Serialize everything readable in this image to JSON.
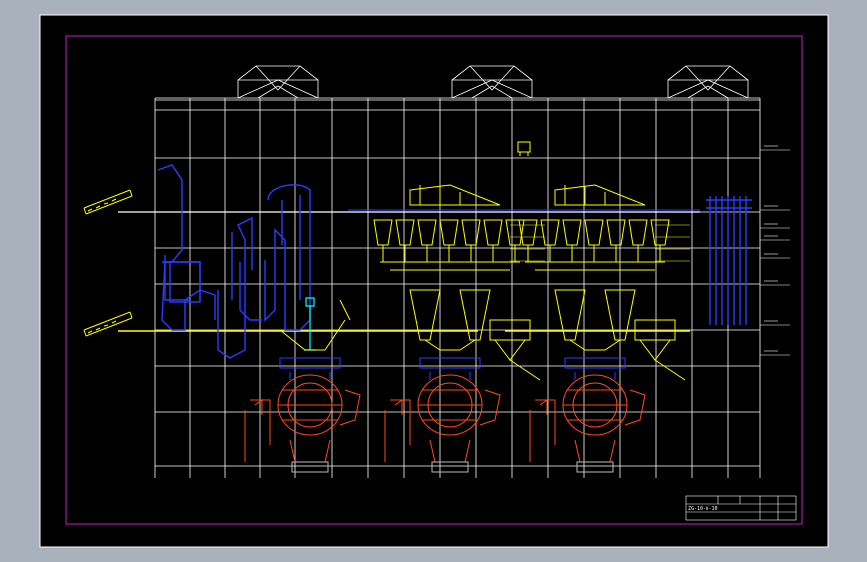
{
  "colors": {
    "viewport_bg": "#a9b1bd",
    "sheet_bg": "#000000",
    "border_outer": "#ffffff",
    "border_inner": "#c21ec2",
    "structure": "#ffffff",
    "equipment_yellow": "#ffff00",
    "equipment_blue": "#2c3cff",
    "equipment_red": "#ff4a1a",
    "equipment_cyan": "#00ffff"
  },
  "drawing": {
    "level_marks": [
      "",
      "",
      "",
      "",
      "",
      "",
      "",
      "",
      ""
    ],
    "title_block": {
      "drawing_title": "ZG-10-Ⅱ-10",
      "cells": [
        "",
        "",
        "",
        "",
        "",
        "",
        "",
        "",
        "",
        "",
        "",
        ""
      ]
    }
  },
  "icons": {
    "roof_monitor": "roof-monitor-icon",
    "conveyor": "belt-conveyor-icon",
    "mill": "ball-mill-icon",
    "hopper": "hopper-icon",
    "silo": "silo-icon"
  }
}
